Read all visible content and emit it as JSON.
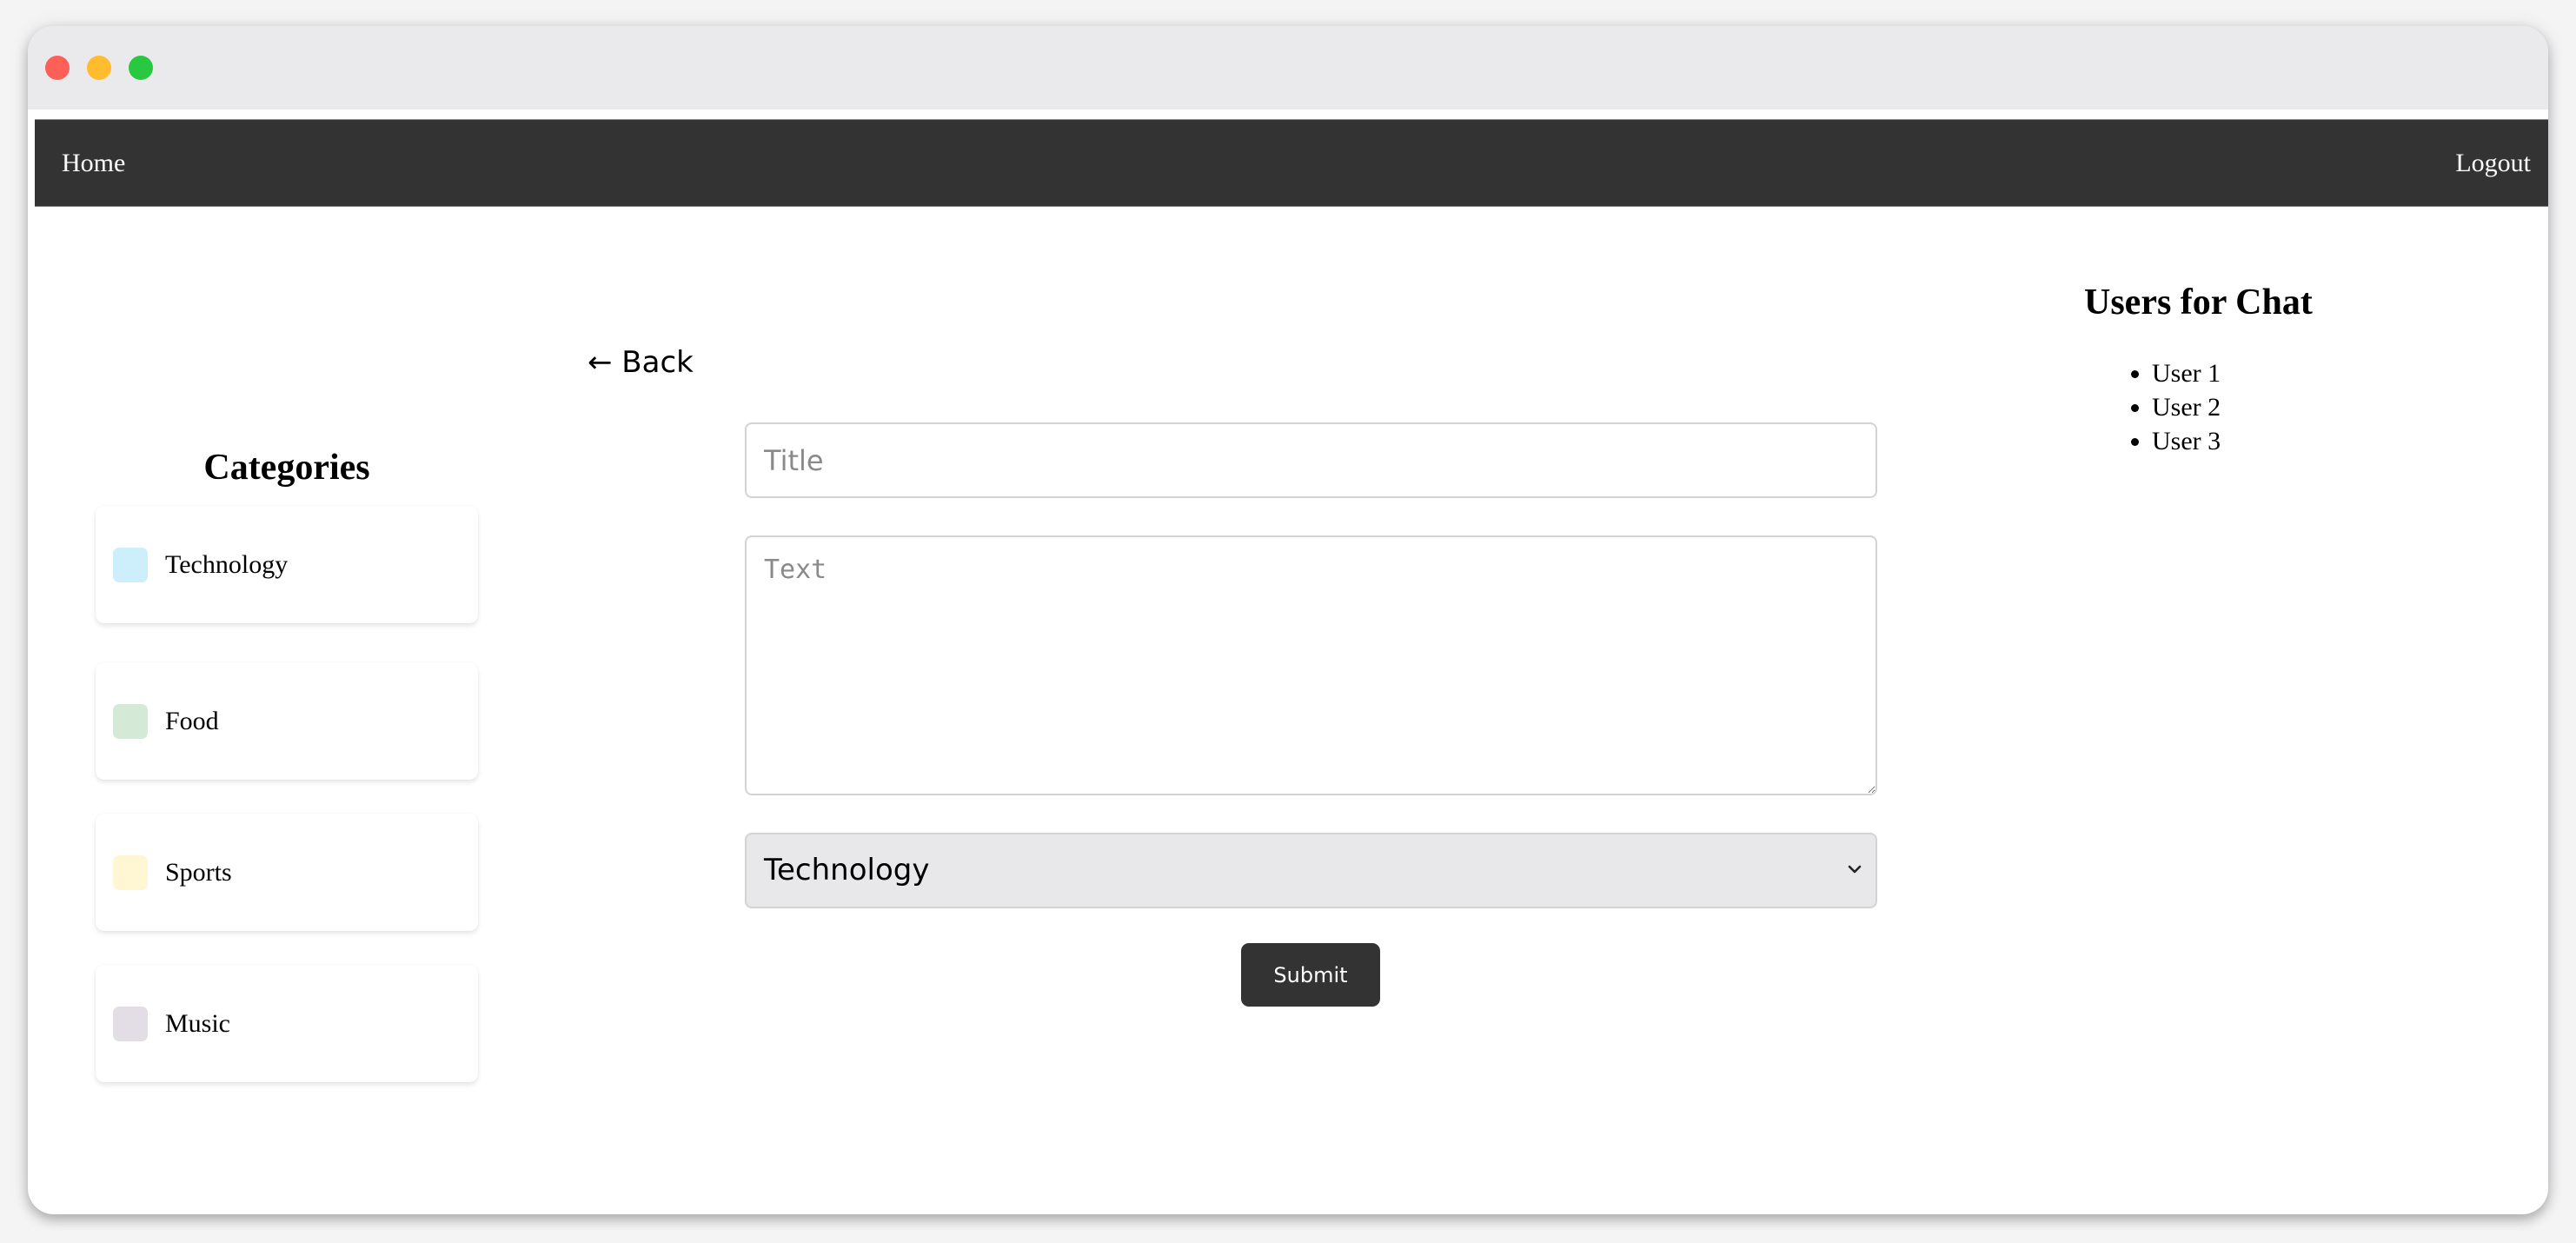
{
  "window": {
    "controls": [
      "close",
      "minimize",
      "maximize"
    ]
  },
  "navbar": {
    "home_label": "Home",
    "logout_label": "Logout"
  },
  "categories": {
    "title": "Categories",
    "items": [
      {
        "label": "Technology",
        "color": "#cdeefb"
      },
      {
        "label": "Food",
        "color": "#d4ead7"
      },
      {
        "label": "Sports",
        "color": "#fff6d3"
      },
      {
        "label": "Music",
        "color": "#e3dde6"
      }
    ]
  },
  "form": {
    "back_label": "← Back",
    "title_placeholder": "Title",
    "title_value": "",
    "text_placeholder": "Text",
    "text_value": "",
    "category_selected": "Technology",
    "submit_label": "Submit"
  },
  "users": {
    "title": "Users for Chat",
    "items": [
      "User 1",
      "User 2",
      "User 3"
    ]
  }
}
